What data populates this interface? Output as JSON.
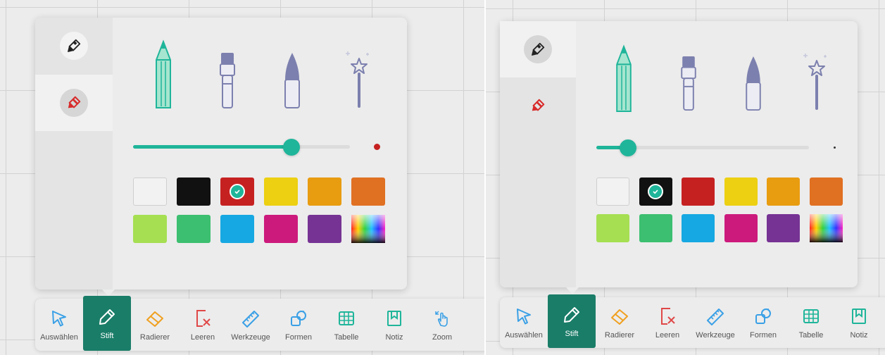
{
  "colors": {
    "accent": "#1fb59a",
    "active_tab": "#1a7d68",
    "icon_blue": "#3aa0e6",
    "icon_orange": "#f0a020",
    "icon_red": "#e04848"
  },
  "pen_tabs": [
    {
      "icon": "fineliner-icon"
    },
    {
      "icon": "highlighter-icon"
    }
  ],
  "pen_tools": [
    {
      "icon": "pencil-icon"
    },
    {
      "icon": "marker-icon"
    },
    {
      "icon": "brush-icon"
    },
    {
      "icon": "magic-wand-icon"
    }
  ],
  "swatches": [
    {
      "name": "white",
      "color": "#f2f2f2"
    },
    {
      "name": "black",
      "color": "#111111"
    },
    {
      "name": "red",
      "color": "#c62121"
    },
    {
      "name": "yellow",
      "color": "#ecd011"
    },
    {
      "name": "amber",
      "color": "#e89c10"
    },
    {
      "name": "orange",
      "color": "#e07022"
    },
    {
      "name": "lime",
      "color": "#a6df52"
    },
    {
      "name": "green",
      "color": "#3cbf70"
    },
    {
      "name": "sky-blue",
      "color": "#16a8e2"
    },
    {
      "name": "magenta",
      "color": "#cc1a7c"
    },
    {
      "name": "purple",
      "color": "#763394"
    },
    {
      "name": "spectrum",
      "color": "gradient"
    }
  ],
  "panels": {
    "left": {
      "active_tab": "highlighter",
      "selected_color": "red",
      "stroke_width_fraction": 0.73
    },
    "right": {
      "active_tab": "fineliner",
      "selected_color": "black",
      "stroke_width_fraction": 0.15
    }
  },
  "toolbar_left": {
    "items": [
      {
        "label": "Auswählen",
        "icon": "cursor-icon"
      },
      {
        "label": "Stift",
        "icon": "pen-icon",
        "active": true
      },
      {
        "label": "Radierer",
        "icon": "eraser-icon"
      },
      {
        "label": "Leeren",
        "icon": "clear-icon"
      },
      {
        "label": "Werkzeuge",
        "icon": "ruler-icon"
      },
      {
        "label": "Formen",
        "icon": "shapes-icon"
      },
      {
        "label": "Tabelle",
        "icon": "table-icon"
      },
      {
        "label": "Notiz",
        "icon": "note-icon"
      },
      {
        "label": "Zoom",
        "icon": "zoom-gesture-icon"
      }
    ]
  },
  "toolbar_right": {
    "items": [
      {
        "label": "Auswählen",
        "icon": "cursor-icon"
      },
      {
        "label": "Stift",
        "icon": "pen-icon",
        "active": true
      },
      {
        "label": "Radierer",
        "icon": "eraser-icon"
      },
      {
        "label": "Leeren",
        "icon": "clear-icon"
      },
      {
        "label": "Werkzeuge",
        "icon": "ruler-icon"
      },
      {
        "label": "Formen",
        "icon": "shapes-icon"
      },
      {
        "label": "Tabelle",
        "icon": "table-icon"
      },
      {
        "label": "Notiz",
        "icon": "note-icon"
      }
    ]
  }
}
